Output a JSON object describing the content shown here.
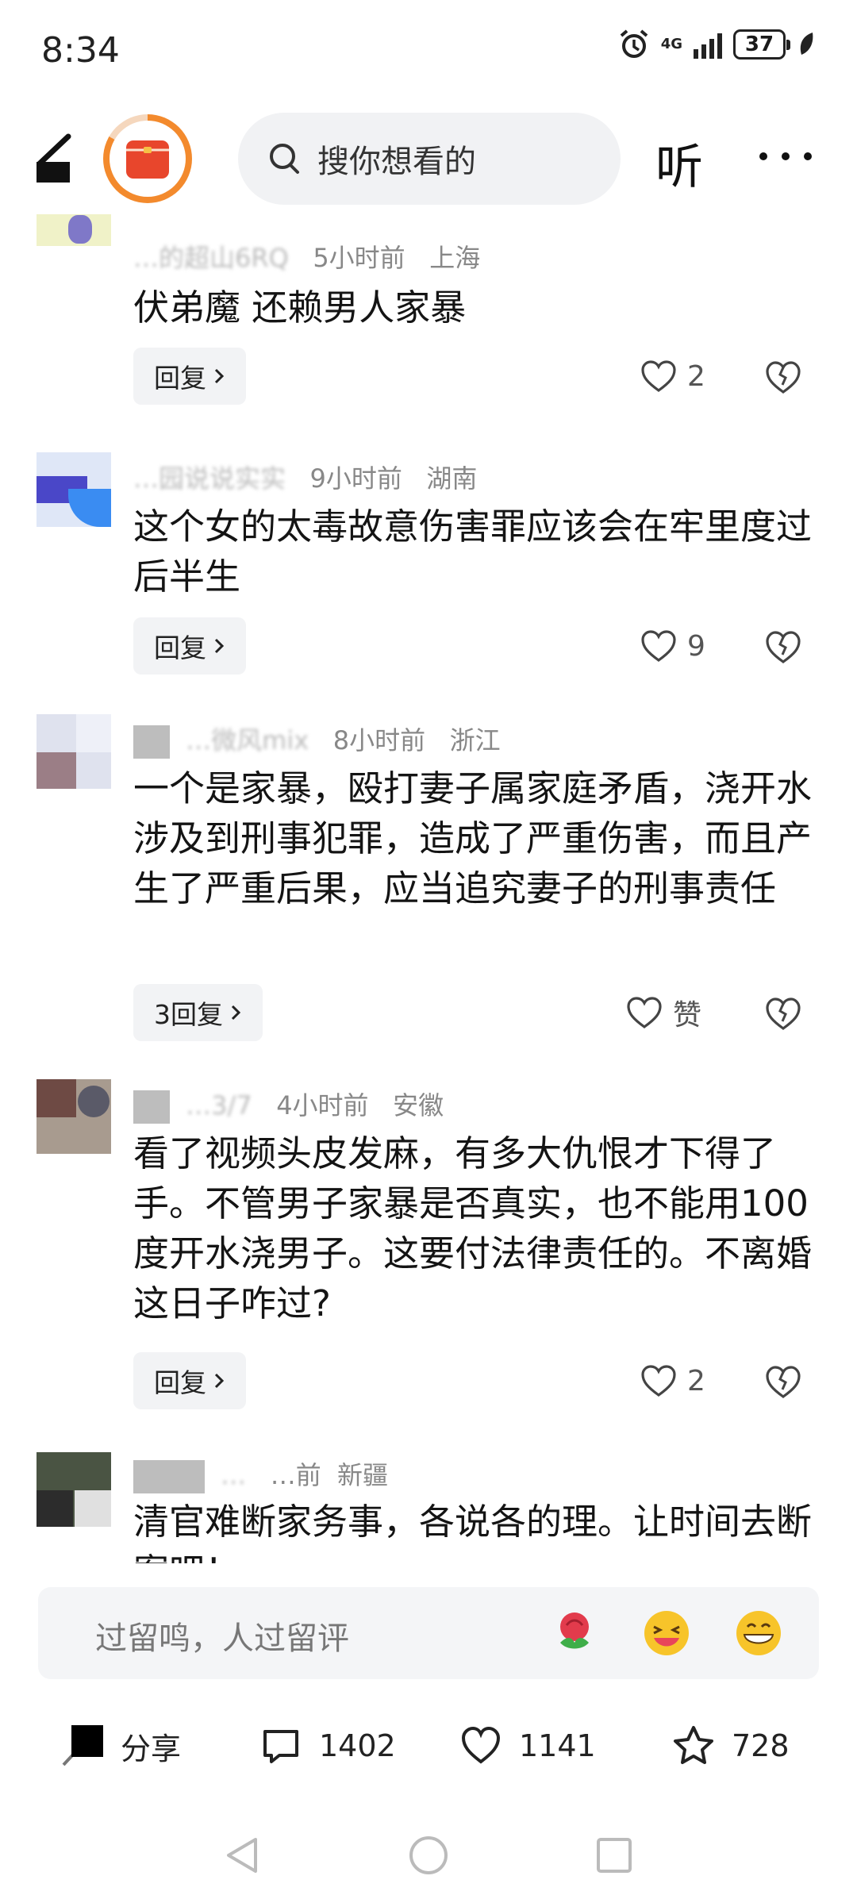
{
  "status_bar": {
    "time": "8:34",
    "network": "4G",
    "battery": "37"
  },
  "header": {
    "search_placeholder": "搜你想看的",
    "listen_label": "听"
  },
  "comments": [
    {
      "user": "…的超山6RQ",
      "time": "5小时前",
      "location": "上海",
      "text": "伏弟魔 还赖男人家暴",
      "reply_label": "回复",
      "likes": "2"
    },
    {
      "user": "…园说说实实",
      "time": "9小时前",
      "location": "湖南",
      "text": "这个女的太毒故意伤害罪应该会在牢里度过后半生",
      "reply_label": "回复",
      "likes": "9"
    },
    {
      "user": "…微风mix",
      "time": "8小时前",
      "location": "浙江",
      "text": "一个是家暴，殴打妻子属家庭矛盾，浇开水涉及到刑事犯罪，造成了严重伤害，而且产生了严重后果，应当追究妻子的刑事责任",
      "reply_label": "3回复",
      "likes": "赞"
    },
    {
      "user": "…3/7",
      "time": "4小时前",
      "location": "安徽",
      "text": "看了视频头皮发麻，有多大仇恨才下得了手。不管男子家暴是否真实，也不能用100度开水浇男子。这要付法律责任的。不离婚这日子咋过?",
      "reply_label": "回复",
      "likes": "2"
    },
    {
      "user": "…",
      "time": "…前",
      "location": "新疆",
      "text": "清官难断家务事，各说各的理。让时间去断案吧！",
      "reply_label": "",
      "likes": ""
    }
  ],
  "comment_input": {
    "placeholder": "过留鸣，人过留评"
  },
  "actions": {
    "share_label": "分享",
    "comments_count": "1402",
    "likes_count": "1141",
    "favorites_count": "728"
  },
  "colors": {
    "accent": "#f38a2d",
    "pill_bg": "#f2f3f5",
    "text": "#141414",
    "meta": "#888888"
  }
}
